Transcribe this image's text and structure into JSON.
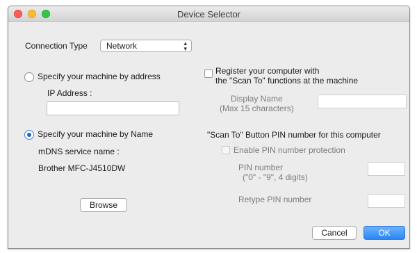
{
  "window": {
    "title": "Device Selector"
  },
  "connection": {
    "label": "Connection Type",
    "selected": "Network"
  },
  "address_option": {
    "label": "Specify your machine by address",
    "ip_label": "IP Address :",
    "ip_value": ""
  },
  "name_option": {
    "label": "Specify your machine by Name",
    "mdns_label": "mDNS service name :",
    "mdns_value": "Brother MFC-J4510DW",
    "browse_label": "Browse"
  },
  "register": {
    "line1": "Register your computer with",
    "line2": "the \"Scan To\" functions at the machine",
    "display_name_line1": "Display Name",
    "display_name_line2": "(Max 15 characters)",
    "display_name_value": ""
  },
  "pin": {
    "heading": "\"Scan To\" Button PIN number for this computer",
    "enable_label": "Enable PIN number protection",
    "pin_line1": "PIN number",
    "pin_line2": "(\"0\" - \"9\",  4 digits)",
    "retype_label": "Retype PIN number"
  },
  "buttons": {
    "cancel": "Cancel",
    "ok": "OK"
  },
  "colors": {
    "accent": "#2a87f5",
    "close": "#fc5f57",
    "minimize": "#fdbc2e",
    "maximize": "#33c748"
  }
}
